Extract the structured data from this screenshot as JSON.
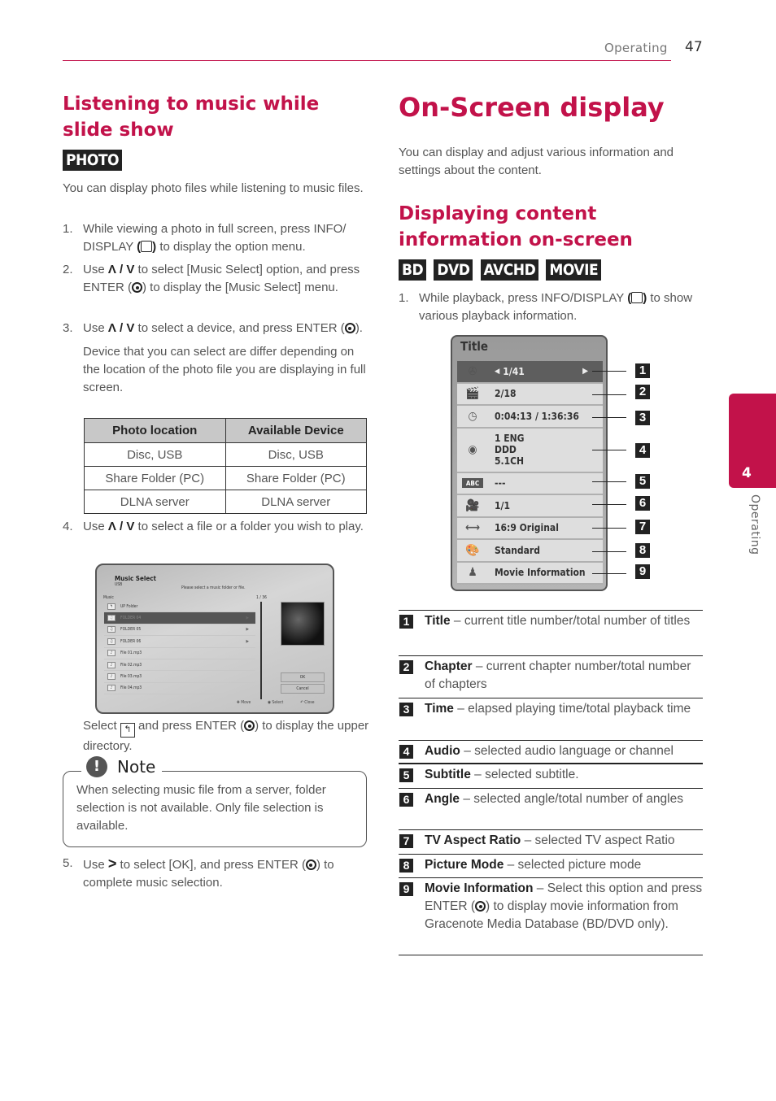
{
  "header": {
    "section": "Operating",
    "page": "47"
  },
  "side_tab": {
    "number": "4",
    "label": "Operating"
  },
  "left": {
    "heading": "Listening to music while slide show",
    "badge": "PHOTO",
    "intro": "You can display photo files while listening to music files.",
    "steps": [
      {
        "num": "1.",
        "pre": "While viewing a photo in full screen, press INFO/ DISPLAY ",
        "post": " to display the option menu."
      },
      {
        "num": "2.",
        "pre": "Use ",
        "arrows": "Λ / V",
        "mid": " to select [Music Select] option, and press ENTER (",
        "post": ") to display the [Music Select] menu."
      },
      {
        "num": "3.",
        "pre": "Use ",
        "arrows": "Λ / V",
        "mid": " to select a device, and press ENTER (",
        "post": ").",
        "extra": "Device that you can select are differ depending on the location of the photo file you are displaying in full screen."
      },
      {
        "num": "4.",
        "pre": "Use ",
        "arrows": "Λ / V",
        "post": " to select a file or a folder you wish to play."
      },
      {
        "num": "5.",
        "pre": "Use ",
        "arrows": ">",
        "mid": " to select [OK], and press ENTER (",
        "post": ") to complete music selection."
      }
    ],
    "table": {
      "headers": [
        "Photo location",
        "Available Device"
      ],
      "rows": [
        [
          "Disc, USB",
          "Disc, USB"
        ],
        [
          "Share Folder (PC)",
          "Share Folder (PC)"
        ],
        [
          "DLNA server",
          "DLNA server"
        ]
      ]
    },
    "music_select": {
      "title": "Music Select",
      "device": "USB",
      "hint": "Please select a music folder or file.",
      "list_label": "Music",
      "count": "1 / 36",
      "items": [
        "UP Folder",
        "FOLDER 04",
        "FOLDER 05",
        "FOLDER 06",
        "File 01.mp3",
        "File 02.mp3",
        "File 03.mp3",
        "File 04.mp3"
      ],
      "ok": "OK",
      "cancel": "Cancel",
      "footer": [
        "Move",
        "Select",
        "Close"
      ]
    },
    "upper_dir": {
      "pre": "Select ",
      "mid": " and press ENTER (",
      "post": ") to display the upper directory."
    },
    "note": {
      "title": "Note",
      "text": "When selecting music file from a server, folder selection is not available. Only file selection is available."
    }
  },
  "right": {
    "title": "On-Screen display",
    "intro": "You can display and adjust various information and settings about the content.",
    "subheading": "Displaying content information on-screen",
    "badges": [
      "BD",
      "DVD",
      "AVCHD",
      "MOVIE"
    ],
    "step1": {
      "num": "1.",
      "pre": "While playback, press INFO/DISPLAY ",
      "post": " to show various playback information."
    },
    "osd": {
      "title": "Title",
      "rows": [
        {
          "icon": "disc-icon",
          "value": "1/41"
        },
        {
          "icon": "clapperboard-icon",
          "value": "2/18"
        },
        {
          "icon": "clock-icon",
          "value": "0:04:13 / 1:36:36"
        },
        {
          "icon": "speaker-icon",
          "value": "1 ENG",
          "value2": "DDD",
          "value3": "5.1CH"
        },
        {
          "icon": "abc-subtitle-icon",
          "value": "---"
        },
        {
          "icon": "camera-icon",
          "value": "1/1"
        },
        {
          "icon": "aspect-icon",
          "value": "16:9 Original"
        },
        {
          "icon": "palette-icon",
          "value": "Standard"
        },
        {
          "icon": "gracenote-icon",
          "value": "Movie Information"
        }
      ]
    },
    "callouts": [
      "1",
      "2",
      "3",
      "4",
      "5",
      "6",
      "7",
      "8",
      "9"
    ],
    "descriptions": [
      {
        "num": "1",
        "term": "Title",
        "text": " – current title number/total number of titles"
      },
      {
        "num": "2",
        "term": "Chapter",
        "text": " – current chapter number/total number of chapters"
      },
      {
        "num": "3",
        "term": "Time",
        "text": " – elapsed playing time/total playback time"
      },
      {
        "num": "4",
        "term": "Audio",
        "text": " – selected audio language or channel"
      },
      {
        "num": "5",
        "term": "Subtitle",
        "text": " – selected subtitle."
      },
      {
        "num": "6",
        "term": "Angle",
        "text": " – selected angle/total number of angles"
      },
      {
        "num": "7",
        "term": "TV Aspect Ratio",
        "text": " – selected TV aspect Ratio"
      },
      {
        "num": "8",
        "term": "Picture Mode",
        "text": " – selected picture mode"
      },
      {
        "num": "9",
        "term": "Movie Information",
        "text": " – Select this option and press ENTER (",
        "text2": ") to display movie information from Gracenote Media Database (BD/DVD only)."
      }
    ]
  }
}
